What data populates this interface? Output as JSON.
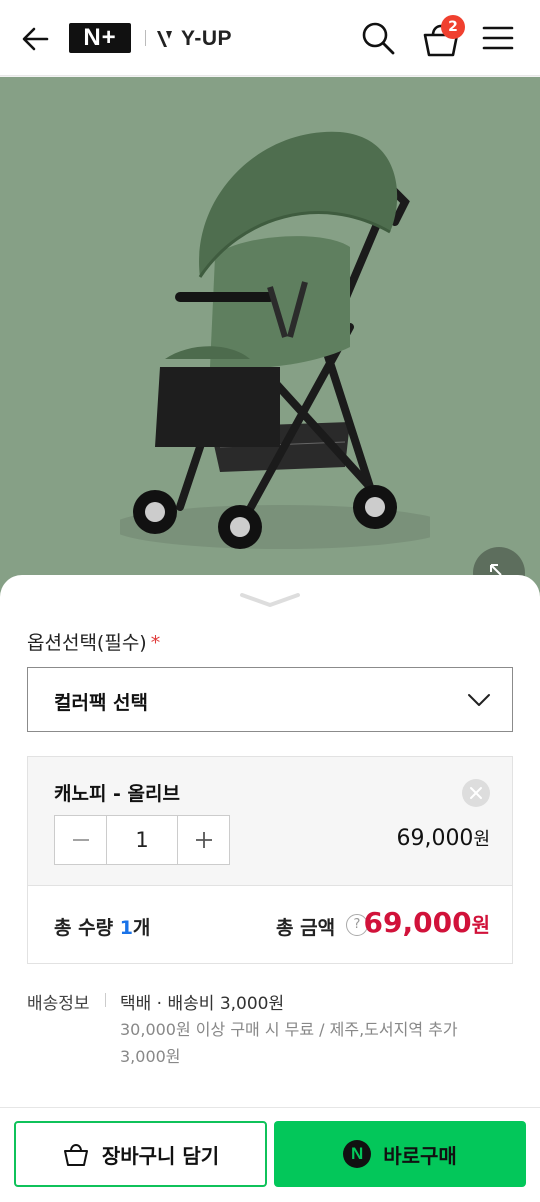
{
  "header": {
    "logo_naver_plus": "N+",
    "logo_brand": "Y-UP",
    "cart_count": "2"
  },
  "hero": {
    "image": "olive-green-stroller-photo",
    "background_color": "#86a086"
  },
  "options": {
    "label": "옵션선택(필수)",
    "required_mark": "*",
    "select_value": "컬러팩 선택"
  },
  "item": {
    "name": "캐노피 - 올리브",
    "quantity": "1",
    "price": "69,000",
    "price_unit": "원"
  },
  "totals": {
    "quantity_label": "총 수량",
    "quantity_value": "1",
    "quantity_unit": "개",
    "amount_label": "총 금액",
    "help_icon": "?",
    "amount_value": "69,000",
    "amount_unit": "원"
  },
  "shipping": {
    "label": "배송정보",
    "main": "택배 · 배송비 3,000원",
    "note": "30,000원 이상 구매 시 무료 / 제주,도서지역 추가 3,000원"
  },
  "buttons": {
    "add_to_cart": "장바구니 담기",
    "buy_now": "바로구매",
    "buy_badge": "N"
  },
  "colors": {
    "accent_green": "#03c75a",
    "price_red": "#d1123a",
    "badge_red": "#f0402f",
    "quantity_blue": "#1a73e8"
  },
  "icons": [
    "back-arrow-icon",
    "search-icon",
    "shopping-basket-icon",
    "hamburger-menu-icon",
    "expand-icon",
    "chevron-down-icon",
    "close-icon",
    "minus-icon",
    "plus-icon",
    "question-icon"
  ]
}
